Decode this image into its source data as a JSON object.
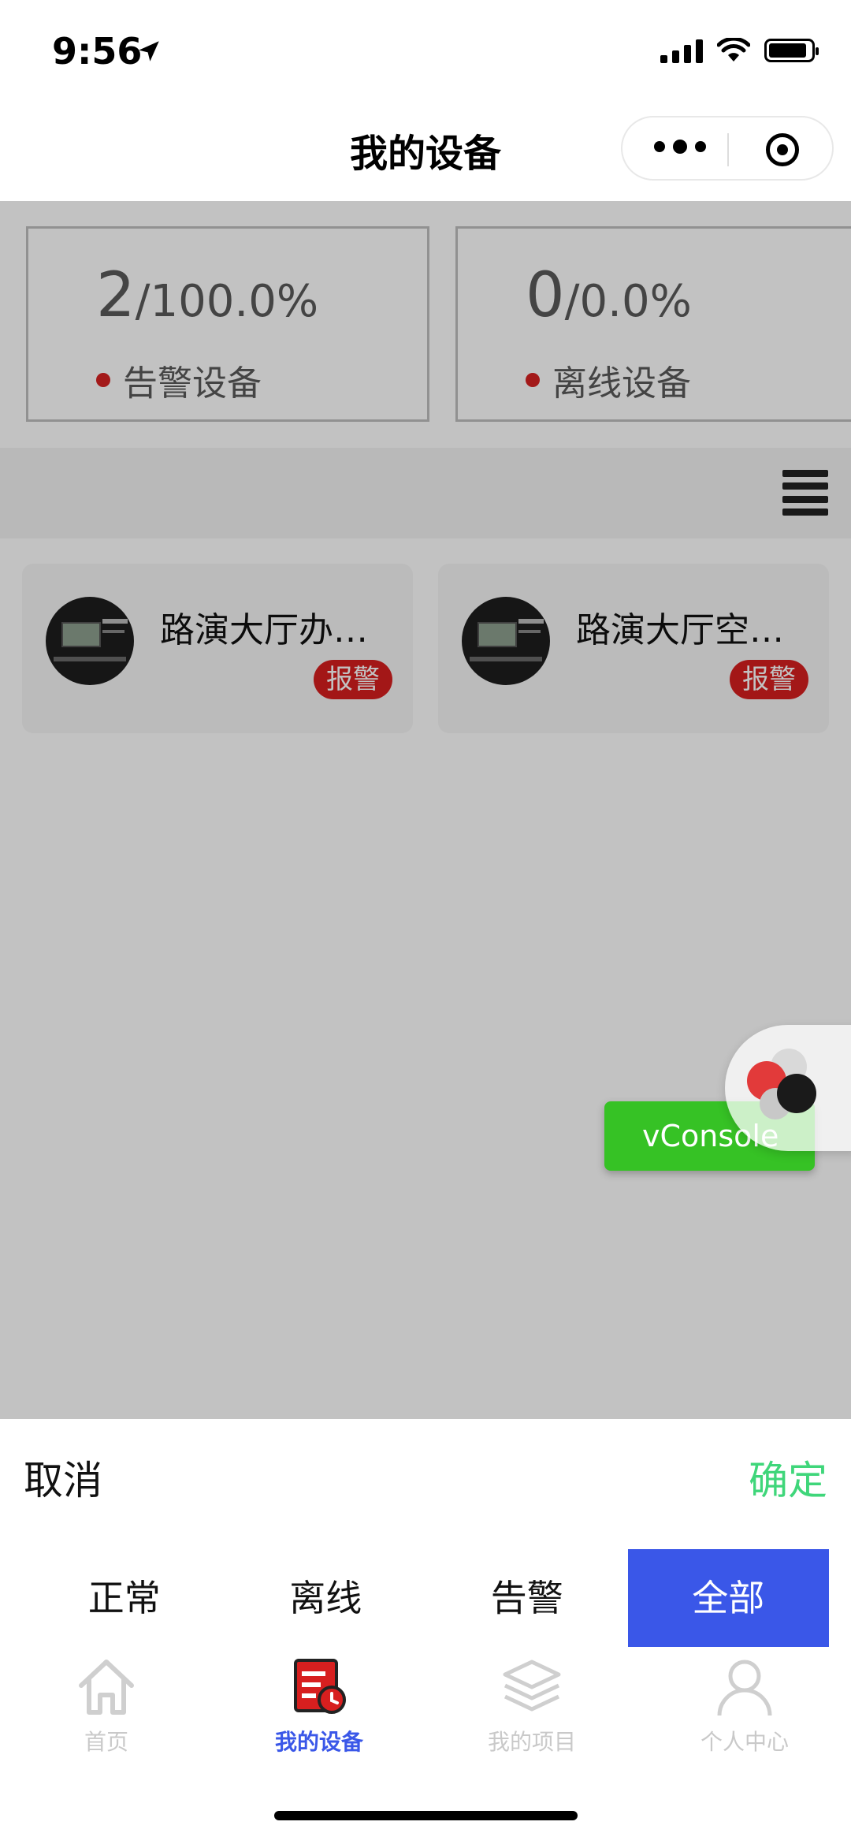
{
  "status_bar": {
    "time": "9:56"
  },
  "nav": {
    "title": "我的设备"
  },
  "stats": [
    {
      "count": "2",
      "percent": "/100.0%",
      "label": "告警设备"
    },
    {
      "count": "0",
      "percent": "/0.0%",
      "label": "离线设备"
    }
  ],
  "devices": [
    {
      "name": "路演大厅办…",
      "status": "报警"
    },
    {
      "name": "路演大厅空…",
      "status": "报警"
    }
  ],
  "vconsole": {
    "label": "vConsole"
  },
  "sheet": {
    "cancel": "取消",
    "confirm": "确定",
    "options": [
      "正常",
      "离线",
      "告警",
      "全部"
    ],
    "selected": "全部"
  },
  "tabbar": [
    {
      "label": "首页",
      "icon": "home-icon"
    },
    {
      "label": "我的设备",
      "icon": "device-icon",
      "active": true
    },
    {
      "label": "我的项目",
      "icon": "layers-icon"
    },
    {
      "label": "个人中心",
      "icon": "user-icon"
    }
  ],
  "colors": {
    "accent": "#3a57e8",
    "confirm": "#3fd67a",
    "alarm": "#d71f1f",
    "vconsole": "#36c225"
  }
}
